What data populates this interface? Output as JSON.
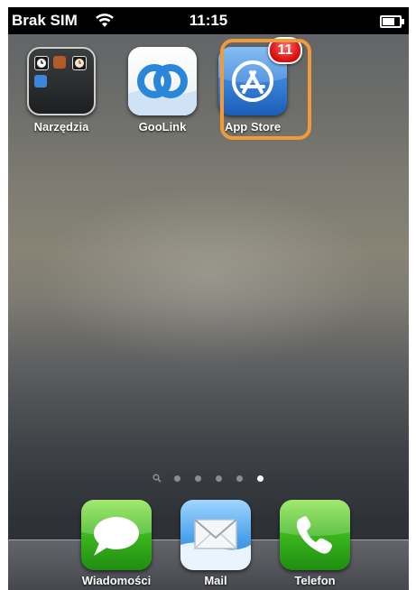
{
  "status_bar": {
    "carrier": "Brak SIM",
    "time": "11:15",
    "icons": [
      "wifi-icon",
      "battery-icon"
    ]
  },
  "home_apps": [
    {
      "label": "Narzędzia",
      "icon": "folder-icon"
    },
    {
      "label": "GooLink",
      "icon": "goolink-icon"
    },
    {
      "label": "App Store",
      "icon": "app-store-icon",
      "badge": "11"
    }
  ],
  "page_indicator": {
    "pages": 6,
    "active_index": 5,
    "first": "search"
  },
  "dock": [
    {
      "label": "Wiadomości",
      "icon": "messages-icon"
    },
    {
      "label": "Mail",
      "icon": "mail-icon"
    },
    {
      "label": "Telefon",
      "icon": "phone-icon"
    }
  ],
  "colors": {
    "highlight": "#f19a3a",
    "badge": "#d80c0c",
    "status_bar": "#000000"
  }
}
